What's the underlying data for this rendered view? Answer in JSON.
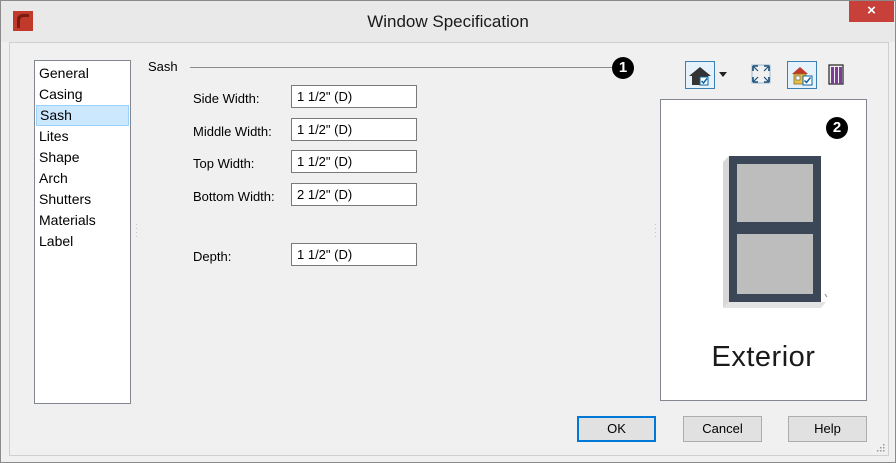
{
  "window": {
    "title": "Window Specification",
    "close_glyph": "×"
  },
  "nav": {
    "items": [
      "General",
      "Casing",
      "Sash",
      "Lites",
      "Shape",
      "Arch",
      "Shutters",
      "Materials",
      "Label"
    ],
    "selected": "Sash"
  },
  "sash": {
    "group_label": "Sash",
    "fields": {
      "side_width": {
        "label": "Side Width:",
        "value": "1 1/2\" (D)"
      },
      "middle_width": {
        "label": "Middle Width:",
        "value": "1 1/2\" (D)"
      },
      "top_width": {
        "label": "Top Width:",
        "value": "1 1/2\" (D)"
      },
      "bottom_width": {
        "label": "Bottom Width:",
        "value": "2 1/2\" (D)"
      },
      "depth": {
        "label": "Depth:",
        "value": "1 1/2\" (D)"
      }
    }
  },
  "callouts": {
    "one": "1",
    "two": "2"
  },
  "preview": {
    "caption": "Exterior"
  },
  "toolbar": {
    "icons": [
      "view-mode-icon",
      "dropdown-arrow-icon",
      "fit-to-window-icon",
      "show-exterior-icon",
      "show-casing-icon"
    ]
  },
  "buttons": {
    "ok": "OK",
    "cancel": "Cancel",
    "help": "Help"
  },
  "colors": {
    "selection_bg": "#cce8ff",
    "close_button": "#c7403a",
    "window_frame": "#3b4656",
    "glass": "#bdbdbd"
  }
}
